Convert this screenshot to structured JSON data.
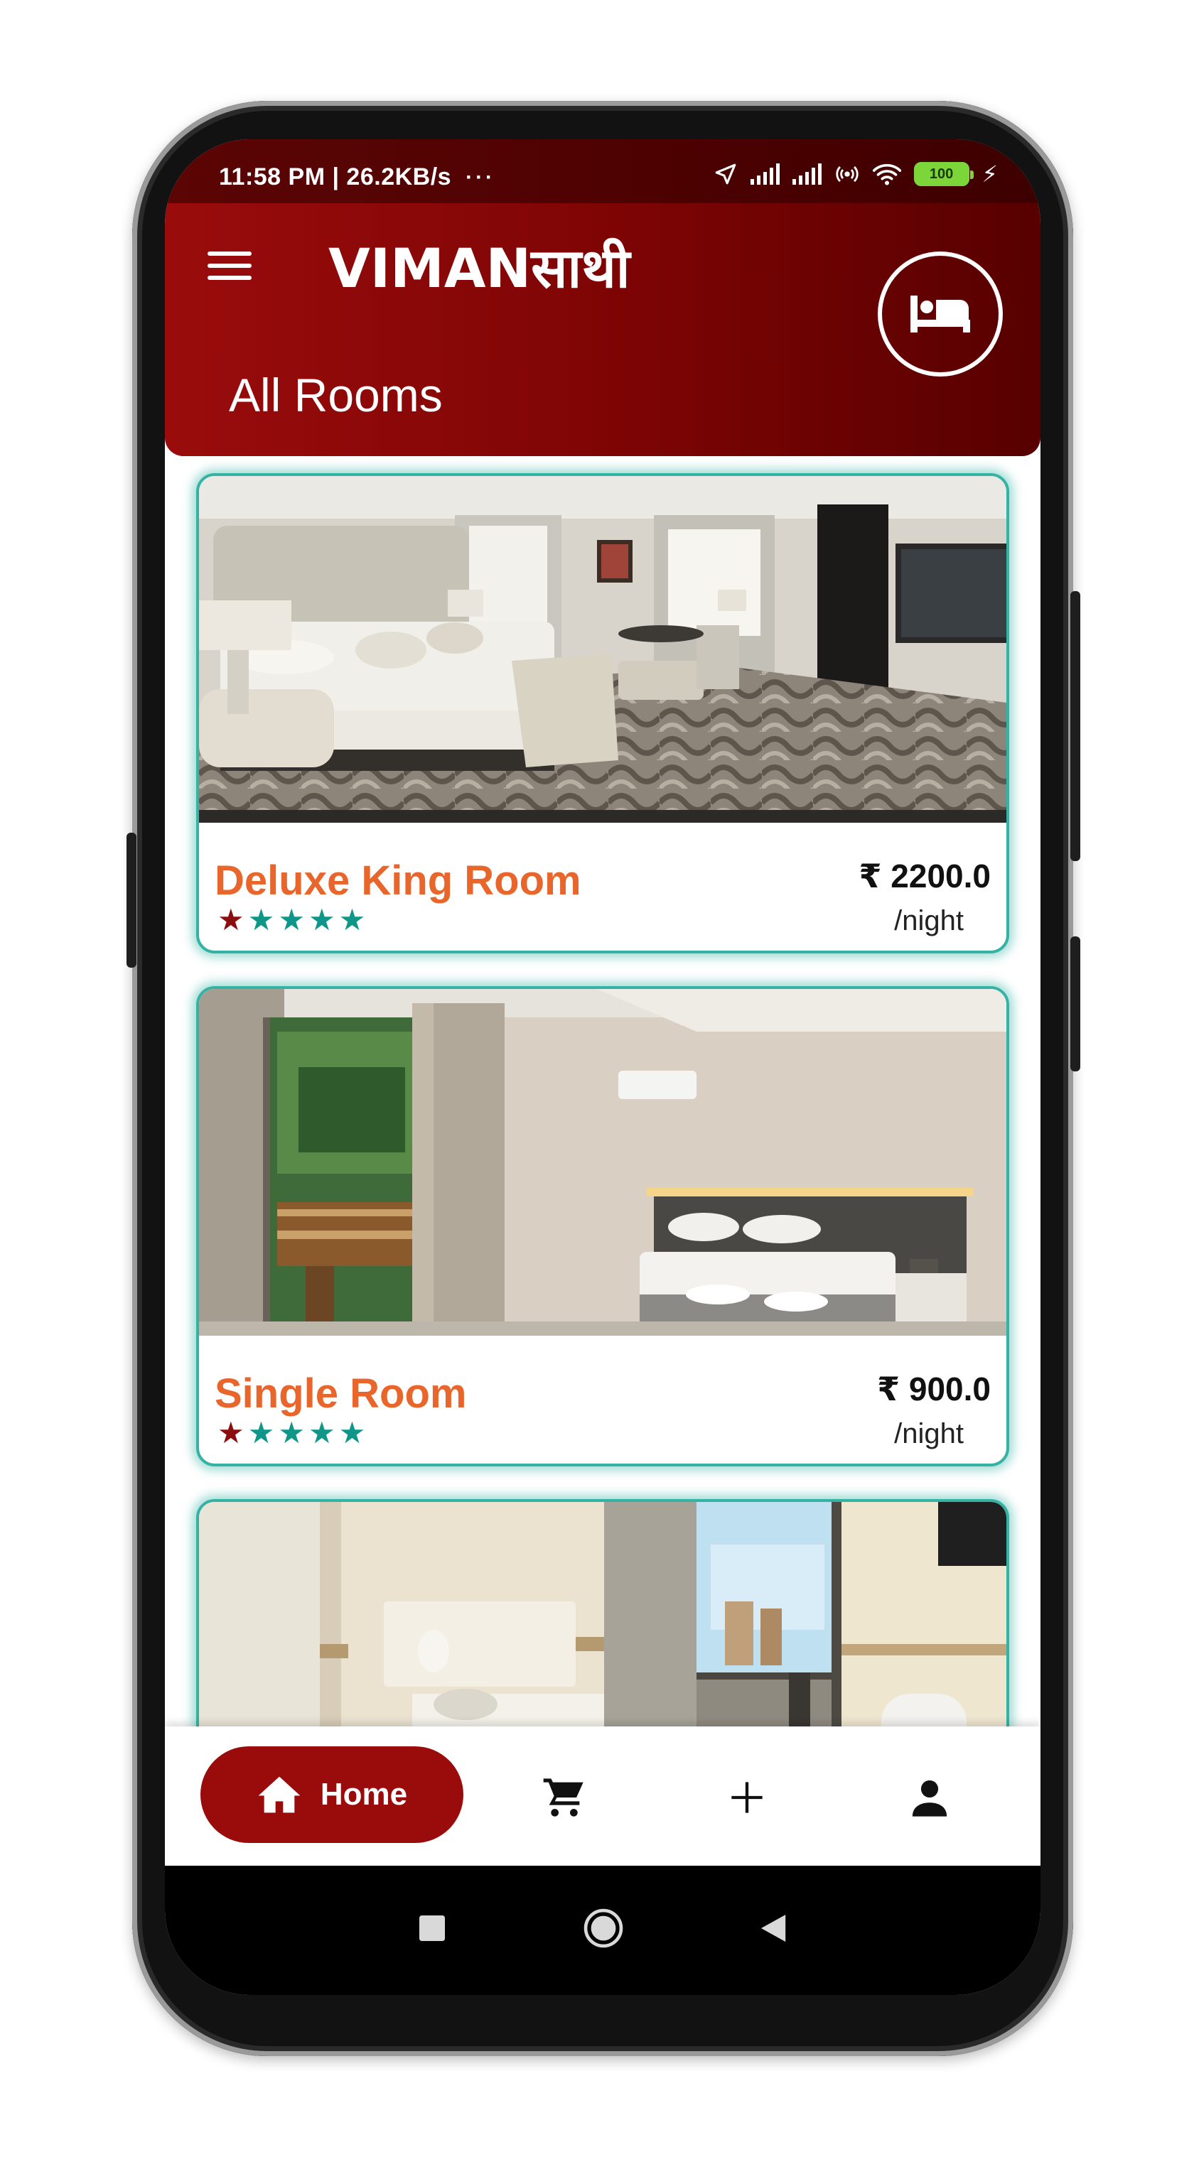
{
  "status_bar": {
    "time_speed": "11:58 PM | 26.2KB/s",
    "more_dots": "···",
    "battery": "100",
    "icons": [
      "location-arrow-icon",
      "signal-icon",
      "signal-icon",
      "hotspot-icon",
      "wifi-icon",
      "battery-icon",
      "charging-icon"
    ]
  },
  "header": {
    "menu_icon": "hamburger-menu-icon",
    "app_title": "VIMANसाथी",
    "hotel_icon": "bed-icon",
    "page_title": "All Rooms"
  },
  "rooms": [
    {
      "name": "Deluxe King Room",
      "price": "₹ 2200.0",
      "per": "/night",
      "rating": 1,
      "max_rating": 5,
      "photo": "deluxe-king-room-photo"
    },
    {
      "name": "Single Room",
      "price": "₹ 900.0",
      "per": "/night",
      "rating": 1,
      "max_rating": 5,
      "photo": "single-room-photo"
    },
    {
      "name": "",
      "price": "",
      "per": "",
      "photo": "third-room-photo"
    }
  ],
  "bottom_nav": {
    "home_label": "Home",
    "items": [
      "home-icon",
      "cart-icon",
      "add-icon",
      "profile-icon"
    ]
  },
  "system_nav": [
    "recent-apps-button",
    "home-button",
    "back-button"
  ],
  "colors": {
    "header_red": "#9a0c0c",
    "header_dark": "#570000",
    "card_border_teal": "#34b3a5",
    "room_name_orange": "#e8662c",
    "star_filled": "#8b0d0d",
    "star_empty_teal": "#0f9688",
    "battery_green": "#7cd63a"
  }
}
